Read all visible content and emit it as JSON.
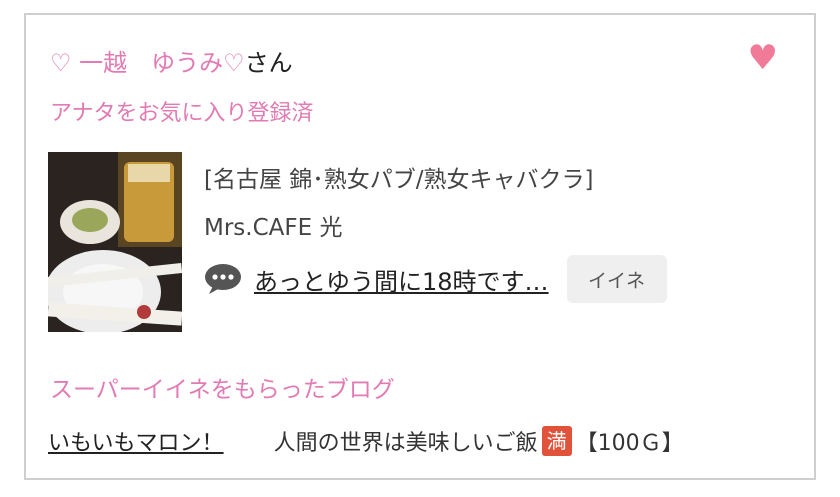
{
  "user": {
    "name_prefix": "♡ 一越　ゆうみ♡",
    "name_suffix": "さん",
    "favorite_status": "アナタをお気に入り登録済"
  },
  "post": {
    "category": "[名古屋 錦･熟女パブ/熟女キャバクラ]",
    "shop": "Mrs.CAFE 光",
    "message": "あっとゆう間に18時です…",
    "like_label": "イイネ"
  },
  "blog_section": {
    "title": "スーパーイイネをもらったブログ",
    "link": "いもいもマロン！",
    "text_before": "人間の世界は美味しいご飯",
    "badge": "満",
    "text_after": "【100Ｇ】"
  },
  "icons": {
    "heart": "heart-icon",
    "comment": "speech-bubble-icon"
  },
  "colors": {
    "accent": "#e27bb3",
    "heart": "#f07a97",
    "badge": "#e0533a"
  }
}
